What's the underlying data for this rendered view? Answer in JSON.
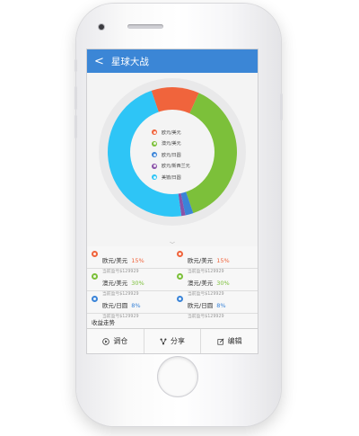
{
  "app": {
    "title": "星球大战",
    "back_glyph": "<"
  },
  "chart_data": {
    "type": "pie",
    "donut": true,
    "slices": [
      {
        "label": "欧元/美元",
        "value": 12,
        "color": "#f0643c"
      },
      {
        "label": "澳元/美元",
        "value": 38,
        "color": "#7cc03a"
      },
      {
        "label": "欧元/日圆",
        "value": 2,
        "color": "#3a84d8"
      },
      {
        "label": "欧元/新西兰元",
        "value": 1,
        "color": "#8a52a8"
      },
      {
        "label": "美镑/日圆",
        "value": 47,
        "color": "#2ec5f6"
      }
    ]
  },
  "legend_items": [
    {
      "label": "欧元/美元",
      "color": "#f0643c"
    },
    {
      "label": "澳元/美元",
      "color": "#7cc03a"
    },
    {
      "label": "欧元/日圆",
      "color": "#3a84d8"
    },
    {
      "label": "欧元/新西兰元",
      "color": "#8a52a8"
    },
    {
      "label": "美镑/日圆",
      "color": "#2ec5f6"
    }
  ],
  "positions": [
    {
      "left": {
        "name": "欧元/美元",
        "pct": "15%",
        "sub": "当前盈亏$129929",
        "color": "#f0643c"
      },
      "right": {
        "name": "欧元/美元",
        "pct": "15%",
        "sub": "当前盈亏$129929",
        "color": "#f0643c"
      }
    },
    {
      "left": {
        "name": "澳元/美元",
        "pct": "30%",
        "sub": "当前盈亏$129929",
        "color": "#7cc03a"
      },
      "right": {
        "name": "澳元/美元",
        "pct": "30%",
        "sub": "当前盈亏$129929",
        "color": "#7cc03a"
      }
    },
    {
      "left": {
        "name": "欧元/日圆",
        "pct": "8%",
        "sub": "当前盈亏$129929",
        "color": "#3a84d8"
      },
      "right": {
        "name": "欧元/日圆",
        "pct": "8%",
        "sub": "当前盈亏$129929",
        "color": "#3a84d8"
      }
    }
  ],
  "section": {
    "title": "收益走势"
  },
  "toolbar": {
    "adjust_label": "调仓",
    "share_label": "分享",
    "edit_label": "编辑"
  }
}
